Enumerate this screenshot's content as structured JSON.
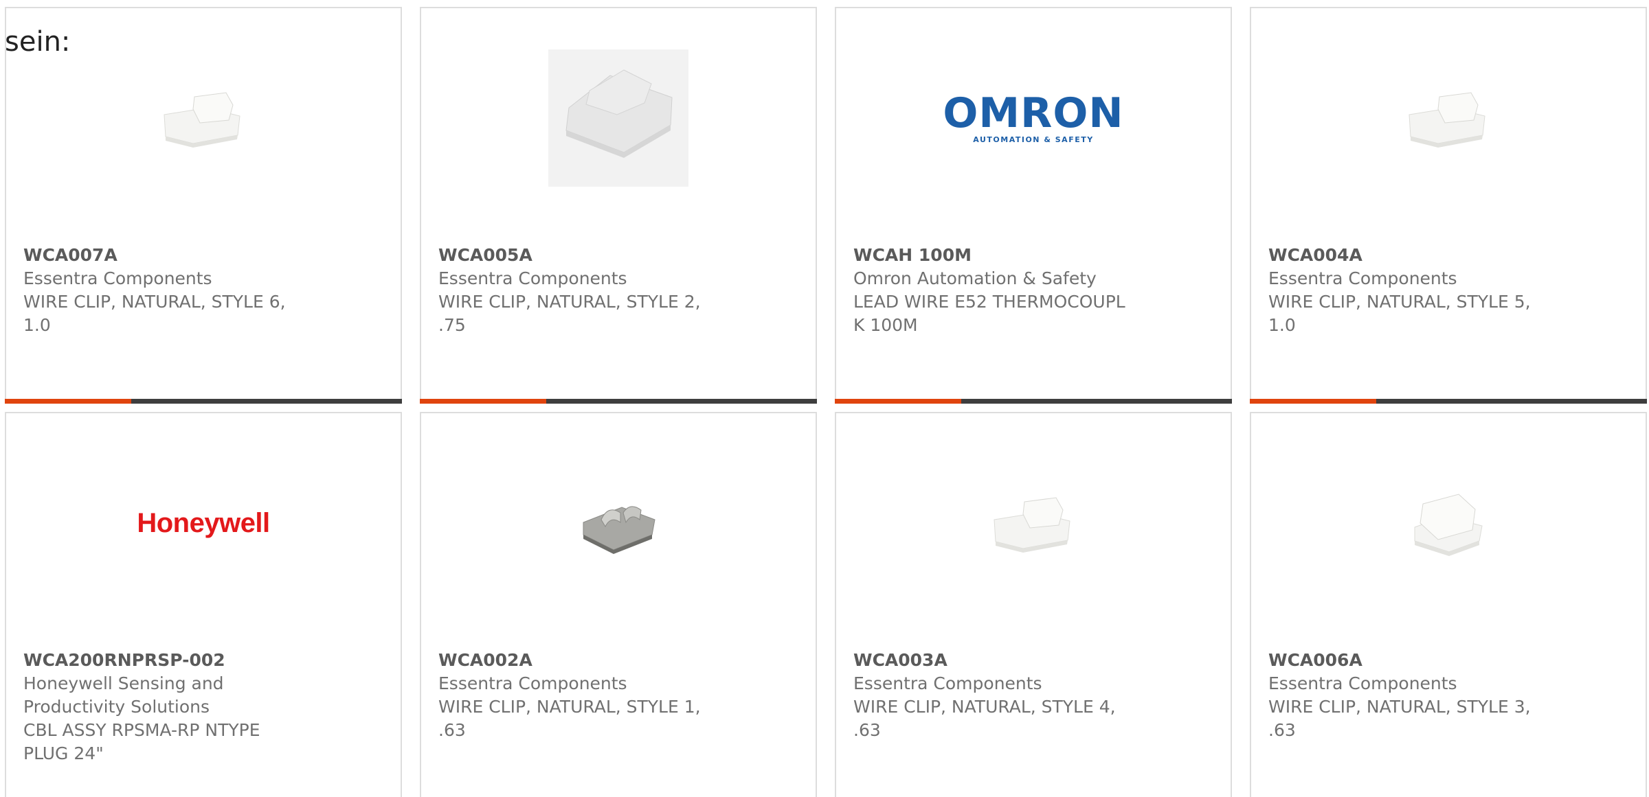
{
  "heading": "sein:",
  "colors": {
    "accent": "#e0440e",
    "bar": "#3e3e3e",
    "border": "#dddddd",
    "text": "#707070"
  },
  "products": [
    {
      "part_number": "WCA007A",
      "manufacturer": "Essentra Components",
      "description_lines": [
        "WIRE CLIP, NATURAL, STYLE 6,",
        "1.0"
      ],
      "image": "wire-clip-style-6"
    },
    {
      "part_number": "WCA005A",
      "manufacturer": "Essentra Components",
      "description_lines": [
        "WIRE CLIP, NATURAL, STYLE 2,",
        ".75"
      ],
      "image": "wire-clip-style-2"
    },
    {
      "part_number": "WCAH 100M",
      "manufacturer": "Omron Automation & Safety",
      "description_lines": [
        "LEAD WIRE E52 THERMOCOUPL",
        "K 100M"
      ],
      "image": "omron-logo",
      "logo": {
        "main": "OMRON",
        "tagline": "AUTOMATION & SAFETY"
      }
    },
    {
      "part_number": "WCA004A",
      "manufacturer": "Essentra Components",
      "description_lines": [
        "WIRE CLIP, NATURAL, STYLE 5,",
        "1.0"
      ],
      "image": "wire-clip-style-5"
    },
    {
      "part_number": "WCA200RNPRSP-002",
      "manufacturer_lines": [
        "Honeywell Sensing and",
        "Productivity Solutions"
      ],
      "description_lines": [
        "CBL ASSY RPSMA-RP NTYPE",
        "PLUG 24\""
      ],
      "image": "honeywell-logo",
      "logo": {
        "main": "Honeywell"
      }
    },
    {
      "part_number": "WCA002A",
      "manufacturer": "Essentra Components",
      "description_lines": [
        "WIRE CLIP, NATURAL, STYLE 1,",
        ".63"
      ],
      "image": "wire-clip-style-1"
    },
    {
      "part_number": "WCA003A",
      "manufacturer": "Essentra Components",
      "description_lines": [
        "WIRE CLIP, NATURAL, STYLE 4,",
        ".63"
      ],
      "image": "wire-clip-style-4"
    },
    {
      "part_number": "WCA006A",
      "manufacturer": "Essentra Components",
      "description_lines": [
        "WIRE CLIP, NATURAL, STYLE 3,",
        ".63"
      ],
      "image": "wire-clip-style-3"
    }
  ]
}
